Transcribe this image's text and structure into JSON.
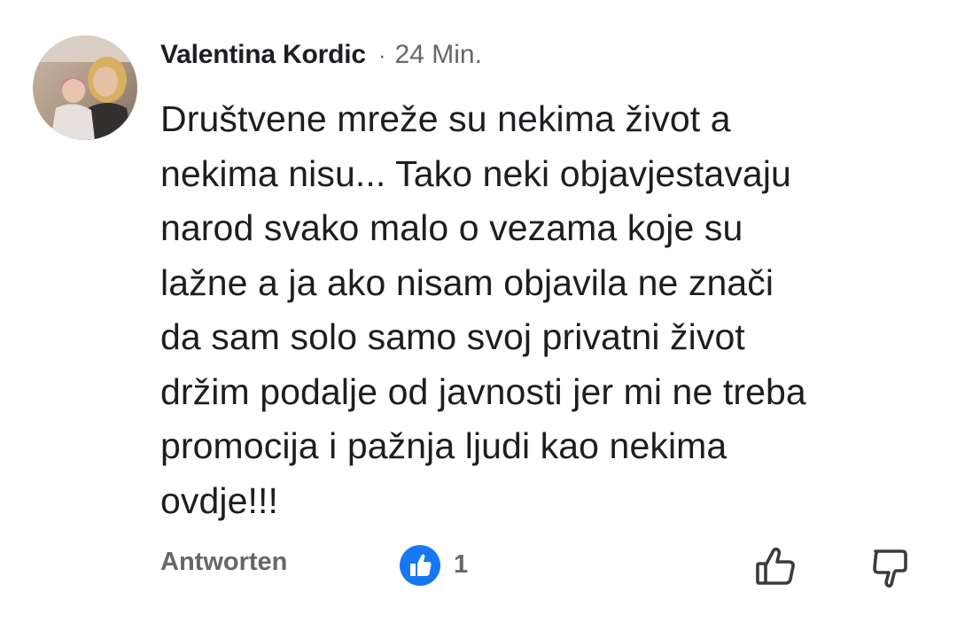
{
  "comment": {
    "author": "Valentina Kordic",
    "separator": "·",
    "timestamp": "24 Min.",
    "text_lines": [
      "Društvene mreže su nekima život a",
      "nekima nisu... Tako neki objavjestavaju",
      "narod svako malo o vezama koje su",
      "lažne a ja ako nisam objavila ne znači",
      "da sam solo samo svoj privatni život",
      "držim podalje od javnosti jer mi ne treba",
      "promocija i pažnja ljudi kao nekima",
      "ovdje!!!"
    ]
  },
  "actions": {
    "reply_label": "Antworten",
    "reaction_count": "1",
    "reaction_icon": "like-reaction-icon",
    "like_icon": "thumbs-up-icon",
    "dislike_icon": "thumbs-down-icon"
  },
  "colors": {
    "text": "#1c1e21",
    "secondary": "#65676b",
    "like_blue": "#1877f2"
  }
}
